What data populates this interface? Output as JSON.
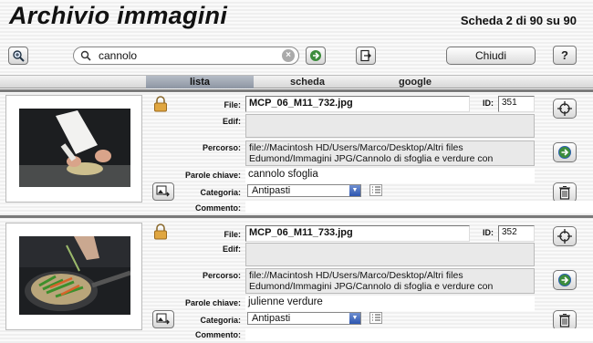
{
  "header": {
    "title": "Archivio immagini",
    "counter": "Scheda 2 di 90 su 90"
  },
  "toolbar": {
    "search_value": "cannolo",
    "close_label": "Chiudi",
    "help_label": "?"
  },
  "tabs": [
    {
      "label": "lista",
      "active": true
    },
    {
      "label": "scheda",
      "active": false
    },
    {
      "label": "google",
      "active": false
    }
  ],
  "labels": {
    "file": "File:",
    "edif": "Edif:",
    "percorso": "Percorso:",
    "parole": "Parole chiave:",
    "categoria": "Categoria:",
    "commento": "Commento:",
    "id": "ID:"
  },
  "records": [
    {
      "file": "MCP_06_M11_732.jpg",
      "id": "351",
      "edif": "",
      "percorso": "file://Macintosh HD/Users/Marco/Desktop/Altri files Edumond/Immagini JPG/Cannolo di sfoglia e verdure con",
      "parole": "cannolo sfoglia",
      "categoria": "Antipasti",
      "commento": ""
    },
    {
      "file": "MCP_06_M11_733.jpg",
      "id": "352",
      "edif": "",
      "percorso": "file://Macintosh HD/Users/Marco/Desktop/Altri files Edumond/Immagini JPG/Cannolo di sfoglia e verdure con",
      "parole": "julienne verdure",
      "categoria": "Antipasti",
      "commento": ""
    }
  ]
}
